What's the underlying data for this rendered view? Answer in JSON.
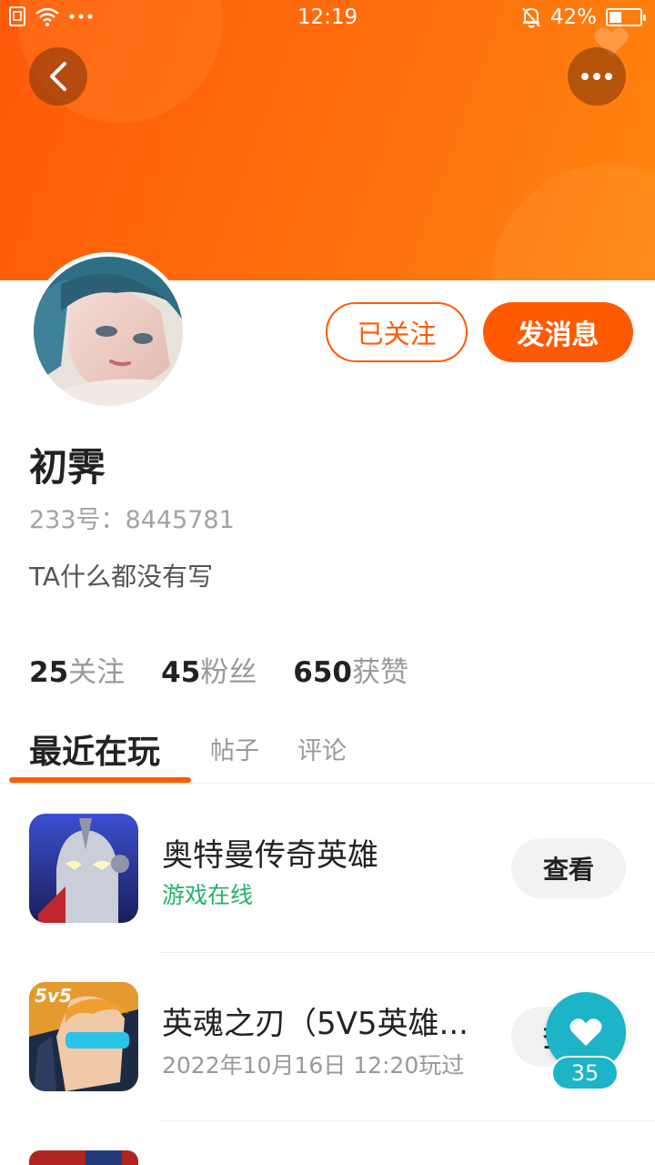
{
  "status_bar": {
    "time": "12:19",
    "battery_percent": "42%",
    "battery_level": 0.42,
    "icons": [
      "sim-icon",
      "wifi-icon",
      "more-dots-icon",
      "mute-bell-icon",
      "battery-icon"
    ]
  },
  "header": {
    "back_icon": "chevron-left-icon",
    "more_icon": "more-horizontal-icon",
    "gradient_colors": [
      "#ff5a0a",
      "#ff850f"
    ]
  },
  "profile": {
    "name": "初霁",
    "id_label": "233号：8445781",
    "bio": "TA什么都没有写",
    "follow_button": "已关注",
    "message_button": "发消息",
    "accent_color": "#ff5a00"
  },
  "stats": [
    {
      "num": "25",
      "label": "关注"
    },
    {
      "num": "45",
      "label": "粉丝"
    },
    {
      "num": "650",
      "label": "获赞"
    }
  ],
  "tabs": [
    {
      "label": "最近在玩",
      "active": true
    },
    {
      "label": "帖子",
      "active": false
    },
    {
      "label": "评论",
      "active": false
    }
  ],
  "games": [
    {
      "title": "奥特曼传奇英雄",
      "subtitle": "游戏在线",
      "button": "查看"
    },
    {
      "title": "英魂之刃（5V5英雄...",
      "subtitle": "2022年10月16日 12:20玩过",
      "button": "查看"
    }
  ],
  "like_fab": {
    "icon": "heart-icon",
    "count": "35",
    "color": "#1db4c7"
  }
}
